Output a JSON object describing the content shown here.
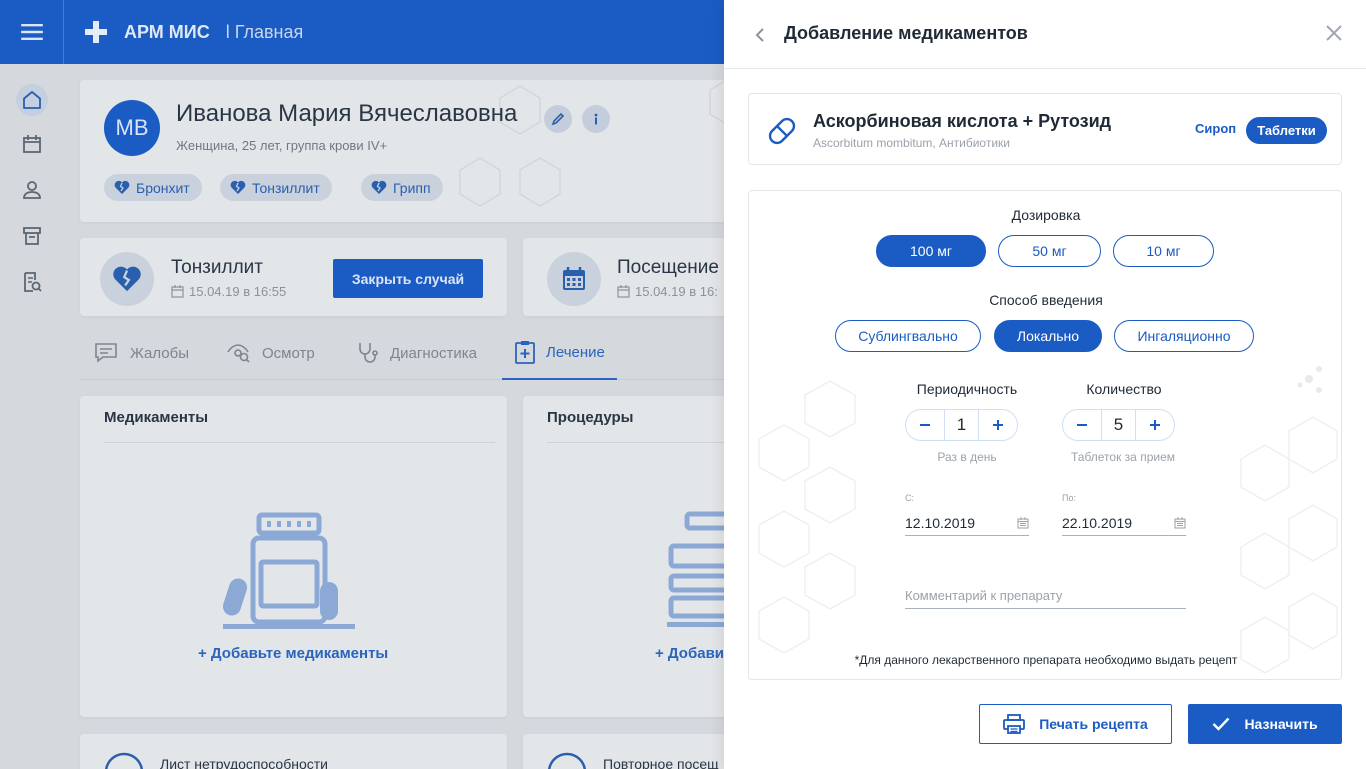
{
  "header": {
    "app_title": "АРМ МИС",
    "page_title": "l Главная",
    "menu_icon": "hamburger-menu-icon",
    "logo_icon": "medical-cross-icon"
  },
  "sidebar": {
    "items": [
      {
        "name": "home",
        "icon": "home-icon",
        "active": true
      },
      {
        "name": "calendar",
        "icon": "calendar-icon",
        "active": false
      },
      {
        "name": "patients",
        "icon": "person-icon",
        "active": false
      },
      {
        "name": "archive",
        "icon": "archive-icon",
        "active": false
      },
      {
        "name": "reports",
        "icon": "document-search-icon",
        "active": false
      }
    ]
  },
  "patient": {
    "initials": "МВ",
    "name": "Иванова Мария Вячеславовна",
    "info": "Женщина, 25 лет, группа крови IV+",
    "diagnoses": [
      "Бронхит",
      "Тонзиллит",
      "Грипп"
    ]
  },
  "case_card": {
    "title": "Тонзиллит",
    "date": "15.04.19 в 16:55",
    "close_label": "Закрыть случай"
  },
  "visit_card": {
    "title": "Посещение",
    "date": "15.04.19 в 16:"
  },
  "tabs": [
    {
      "label": "Жалобы",
      "active": false
    },
    {
      "label": "Осмотр",
      "active": false
    },
    {
      "label": "Диагностика",
      "active": false
    },
    {
      "label": "Лечение",
      "active": true
    }
  ],
  "panels": {
    "meds_title": "Медикаменты",
    "meds_add": "+ Добавьте медикаменты",
    "proc_title": "Процедуры",
    "proc_add": "+ Добавит",
    "bottom_left": "Лист нетрудоспособности",
    "bottom_right": "Повторное посещ"
  },
  "drawer": {
    "title": "Добавление медикаментов",
    "drug": {
      "name": "Аскорбиновая кислота + Рутозид",
      "subtitle": "Ascorbitum mombitum, Антибиотики",
      "form_option": "Сироп",
      "form_selected": "Таблетки"
    },
    "dosage_label": "Дозировка",
    "dosages": [
      "100 мг",
      "50 мг",
      "10 мг"
    ],
    "dosage_selected": "100 мг",
    "route_label": "Способ введения",
    "routes": [
      "Сублингвально",
      "Локально",
      "Ингаляционно"
    ],
    "route_selected": "Локально",
    "frequency": {
      "label": "Периодичность",
      "value": "1",
      "hint": "Раз в день"
    },
    "quantity": {
      "label": "Количество",
      "value": "5",
      "hint": "Таблеток за прием"
    },
    "date_from": {
      "label": "С:",
      "value": "12.10.2019"
    },
    "date_to": {
      "label": "По:",
      "value": "22.10.2019"
    },
    "comment_placeholder": "Комментарий к препарату",
    "note": "*Для данного лекарственного препарата необходимо выдать рецепт",
    "print_label": "Печать рецепта",
    "assign_label": "Назначить"
  },
  "colors": {
    "primary": "#1a5bc4",
    "overlay_bg": "#d5d9de",
    "text": "#1f2a36"
  }
}
